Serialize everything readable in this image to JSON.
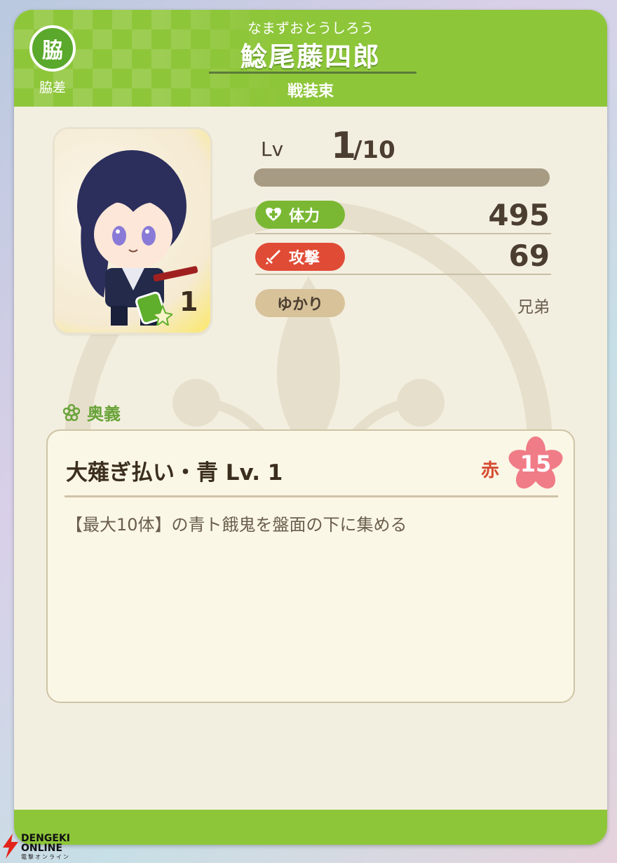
{
  "header": {
    "badge_char": "脇",
    "badge_label": "脇差",
    "furigana": "なまずおとうしろう",
    "name": "鯰尾藤四郎",
    "costume": "戦装束"
  },
  "portrait": {
    "stack_count": "1"
  },
  "level": {
    "label": "Lv",
    "current": "1",
    "max": "/10",
    "progress_fraction": 0.0
  },
  "stats": {
    "hp_label": "体力",
    "hp_value": "495",
    "attack_label": "攻撃",
    "attack_value": "69",
    "yukari_label": "ゆかり",
    "yukari_value": "兄弟"
  },
  "ougi": {
    "heading": "奥義",
    "skill_title": "大薙ぎ払い・青 Lv. 1",
    "color_label": "赤",
    "cost": "15",
    "description": "【最大10体】の青ト餓鬼を盤面の下に集める"
  },
  "colors": {
    "header_green": "#8ec63a",
    "hp_green": "#7ab834",
    "attack_red": "#e04b36",
    "sakura_pink": "#f07c88"
  },
  "watermark": {
    "brand_top": "DENGEKI",
    "brand_bottom": "ONLINE",
    "brand_sub": "電撃オンライン"
  }
}
